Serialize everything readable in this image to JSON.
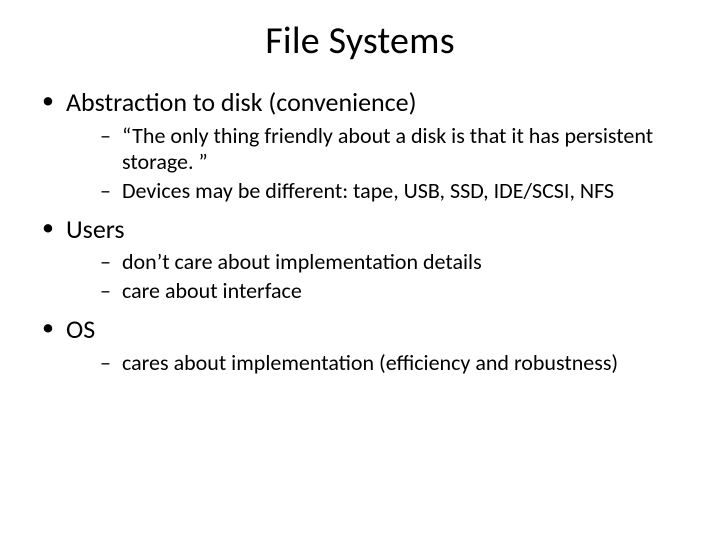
{
  "title": "File Systems",
  "bullets": [
    {
      "text": "Abstraction to disk (convenience)",
      "sub": [
        "“The only thing friendly about a disk is that it has persistent storage. ”",
        "Devices may be different: tape, USB, SSD, IDE/SCSI, NFS"
      ]
    },
    {
      "text": "Users",
      "sub": [
        "don’t care about implementation details",
        "care about interface"
      ]
    },
    {
      "text": "OS",
      "sub": [
        "cares about implementation (efficiency and robustness)"
      ]
    }
  ]
}
